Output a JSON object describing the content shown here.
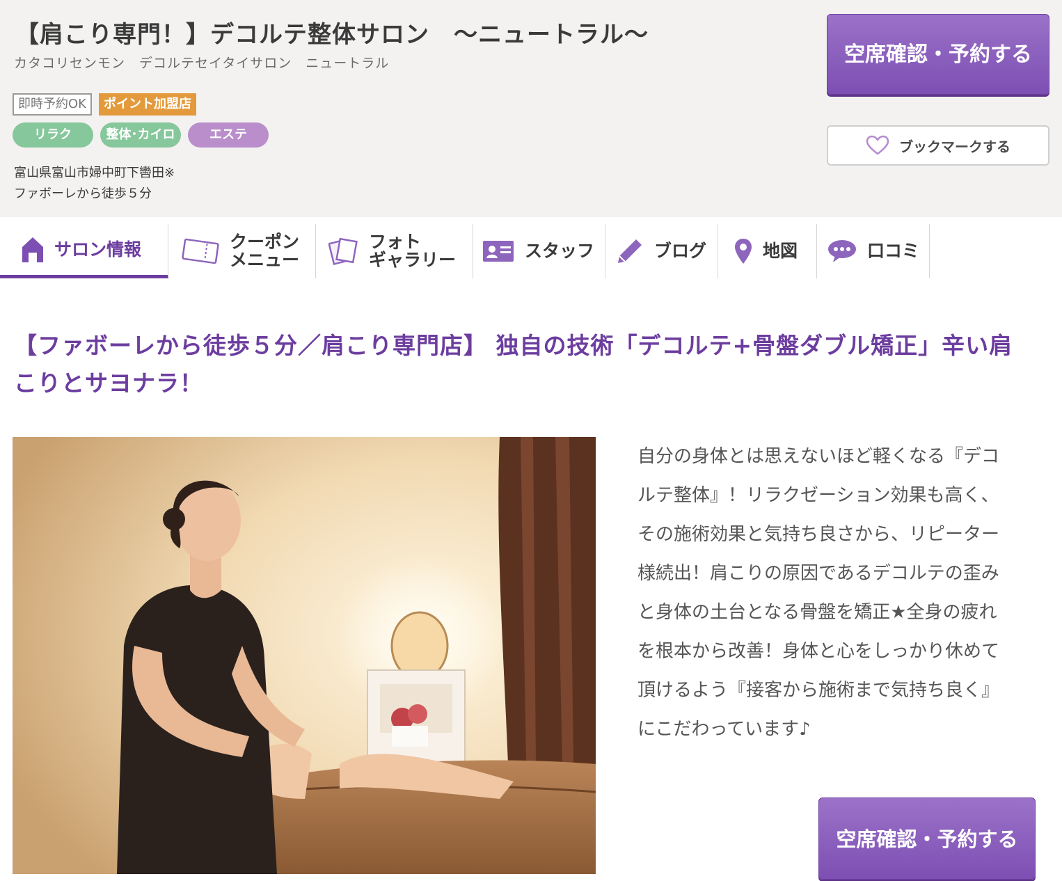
{
  "header": {
    "title": "【肩こり専門！】デコルテ整体サロン　〜ニュートラル〜",
    "kana": "カタコリセンモン　デコルテセイタイサロン　ニュートラル",
    "badges": [
      "即時予約OK",
      "ポイント加盟店"
    ],
    "genres": [
      "リラク",
      "整体･カイロ",
      "エステ"
    ],
    "address": "富山県富山市婦中町下轡田※",
    "access": "ファボーレから徒歩５分",
    "reserve_label": "空席確認・予約する",
    "bookmark_label": "ブックマークする"
  },
  "nav": {
    "items": [
      {
        "label": "サロン情報",
        "icon": "home-icon",
        "active": true
      },
      {
        "label1": "クーポン",
        "label2": "メニュー",
        "icon": "coupon-icon"
      },
      {
        "label1": "フォト",
        "label2": "ギャラリー",
        "icon": "photo-icon"
      },
      {
        "label": "スタッフ",
        "icon": "staff-card-icon"
      },
      {
        "label": "ブログ",
        "icon": "pencil-icon"
      },
      {
        "label": "地図",
        "icon": "map-pin-icon"
      },
      {
        "label": "口コミ",
        "icon": "speech-bubble-icon"
      }
    ],
    "accent_color": "#6c3d9f"
  },
  "main": {
    "catch_copy": "【ファボーレから徒歩５分／肩こり専門店】 独自の技術「デコルテ+骨盤ダブル矯正」辛い肩こりとサヨナラ！",
    "description": "自分の身体とは思えないほど軽くなる『デコルテ整体』！リラクゼーション効果も高く、その施術効果と気持ち良さから、リピーター様続出！肩こりの原因であるデコルテの歪みと身体の土台となる骨盤を矯正★全身の疲れを根本から改善！身体と心をしっかり休めて頂けるよう『接客から施術まで気持ち良く』にこだわっています♪",
    "reserve_label": "空席確認・予約する"
  },
  "colors": {
    "brand_purple": "#7d4fb3",
    "header_bg": "#f4f2f0",
    "point_orange": "#e39a3c",
    "genre_green": "#86c79b",
    "genre_purple": "#b98ecb"
  }
}
